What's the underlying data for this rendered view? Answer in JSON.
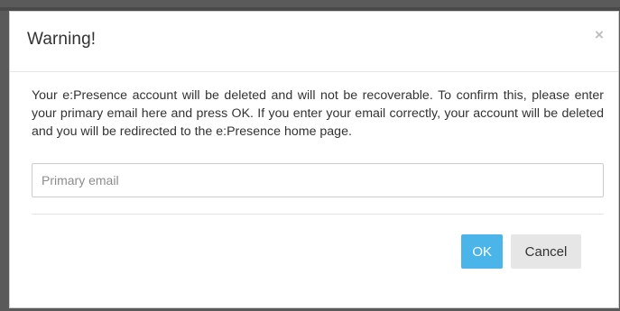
{
  "dialog": {
    "title": "Warning!",
    "close_symbol": "×",
    "message": "Your e:Presence account will be deleted and will not be recoverable. To confirm this, please enter your primary email here and press OK. If you enter your email correctly, your account will be deleted and you will be redirected to the e:Presence home page.",
    "email_input": {
      "value": "",
      "placeholder": "Primary email"
    },
    "ok_label": "OK",
    "cancel_label": "Cancel"
  },
  "colors": {
    "ok_button": "#4bb4e8",
    "cancel_button": "#e6e6e6",
    "backdrop": "#5a5a5a"
  },
  "icons": {
    "close": "close-icon"
  }
}
